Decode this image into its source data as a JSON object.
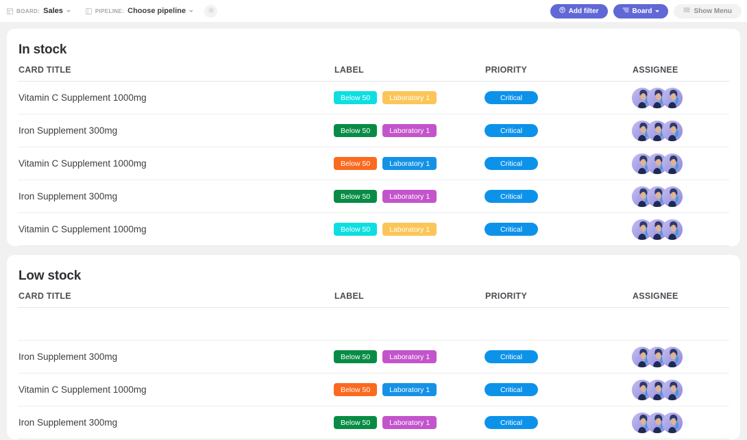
{
  "toolbar": {
    "board_kicker": "BOARD:",
    "board_value": "Sales",
    "pipeline_kicker": "PIPELINE:",
    "pipeline_value": "Choose pipeline",
    "settings_icon": "gear-icon",
    "board_icon": "board-grid-icon",
    "pipeline_icon": "pipeline-columns-icon",
    "add_filter_label": "Add filter",
    "add_filter_icon": "filter-icon",
    "view_label": "Board",
    "view_icon": "board-view-icon",
    "show_menu_label": "Show Menu",
    "show_menu_icon": "hamburger-icon"
  },
  "colors": {
    "accent": "#6068d6",
    "page_bg": "#f1f1f2",
    "card_bg": "#ffffff",
    "cyan": "#0ddfe0",
    "green": "#088c45",
    "orange": "#fb6a1e",
    "yellow": "#fbc657",
    "purple": "#c354cc",
    "blue": "#1592e6",
    "critical": "#0d92ea"
  },
  "columns": [
    "CARD TITLE",
    "LABEL",
    "PRIORITY",
    "ASSIGNEE"
  ],
  "groups": [
    {
      "title": "In stock",
      "rows": [
        {
          "title": "Vitamin C Supplement 1000mg",
          "labels": [
            {
              "text": "Below 50",
              "color": "#0ddfe0"
            },
            {
              "text": "Laboratory 1",
              "color": "#fbc657"
            }
          ],
          "priority": {
            "text": "Critical",
            "color": "#0d92ea"
          },
          "assignees": 3
        },
        {
          "title": "Iron Supplement 300mg",
          "labels": [
            {
              "text": "Below 50",
              "color": "#088c45"
            },
            {
              "text": "Laboratory 1",
              "color": "#c354cc"
            }
          ],
          "priority": {
            "text": "Critical",
            "color": "#0d92ea"
          },
          "assignees": 3
        },
        {
          "title": "Vitamin C Supplement 1000mg",
          "labels": [
            {
              "text": "Below 50",
              "color": "#fb6a1e"
            },
            {
              "text": "Laboratory 1",
              "color": "#1592e6"
            }
          ],
          "priority": {
            "text": "Critical",
            "color": "#0d92ea"
          },
          "assignees": 3
        },
        {
          "title": "Iron Supplement 300mg",
          "labels": [
            {
              "text": "Below 50",
              "color": "#088c45"
            },
            {
              "text": "Laboratory 1",
              "color": "#c354cc"
            }
          ],
          "priority": {
            "text": "Critical",
            "color": "#0d92ea"
          },
          "assignees": 3
        },
        {
          "title": "Vitamin C Supplement 1000mg",
          "labels": [
            {
              "text": "Below 50",
              "color": "#0ddfe0"
            },
            {
              "text": "Laboratory 1",
              "color": "#fbc657"
            }
          ],
          "priority": {
            "text": "Critical",
            "color": "#0d92ea"
          },
          "assignees": 3
        }
      ]
    },
    {
      "title": "Low stock",
      "rows": [
        {
          "title": "",
          "labels": [],
          "priority": null,
          "assignees": 0
        },
        {
          "title": "Iron Supplement 300mg",
          "labels": [
            {
              "text": "Below 50",
              "color": "#088c45"
            },
            {
              "text": "Laboratory 1",
              "color": "#c354cc"
            }
          ],
          "priority": {
            "text": "Critical",
            "color": "#0d92ea"
          },
          "assignees": 3
        },
        {
          "title": "Vitamin C Supplement 1000mg",
          "labels": [
            {
              "text": "Below 50",
              "color": "#fb6a1e"
            },
            {
              "text": "Laboratory 1",
              "color": "#1592e6"
            }
          ],
          "priority": {
            "text": "Critical",
            "color": "#0d92ea"
          },
          "assignees": 3
        },
        {
          "title": "Iron Supplement 300mg",
          "labels": [
            {
              "text": "Below 50",
              "color": "#088c45"
            },
            {
              "text": "Laboratory 1",
              "color": "#c354cc"
            }
          ],
          "priority": {
            "text": "Critical",
            "color": "#0d92ea"
          },
          "assignees": 3
        }
      ]
    }
  ]
}
